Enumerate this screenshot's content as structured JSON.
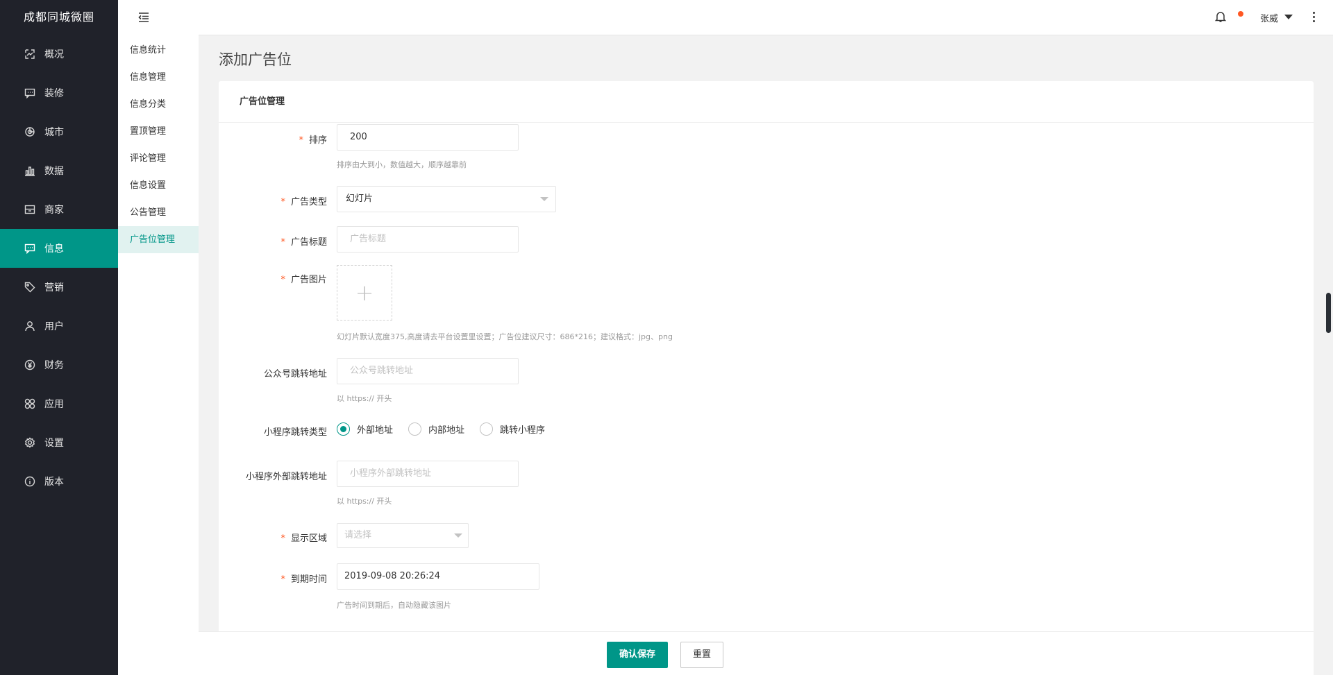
{
  "app": {
    "brand": "成都同城微圈"
  },
  "sidebar": {
    "items": [
      {
        "label": "概况",
        "icon": "dashboard-icon"
      },
      {
        "label": "装修",
        "icon": "chat-icon"
      },
      {
        "label": "城市",
        "icon": "pie-icon"
      },
      {
        "label": "数据",
        "icon": "bar-chart-icon"
      },
      {
        "label": "商家",
        "icon": "store-icon"
      },
      {
        "label": "信息",
        "icon": "message-icon",
        "active": true
      },
      {
        "label": "营销",
        "icon": "tag-icon"
      },
      {
        "label": "用户",
        "icon": "user-icon"
      },
      {
        "label": "财务",
        "icon": "yen-icon"
      },
      {
        "label": "应用",
        "icon": "apps-icon"
      },
      {
        "label": "设置",
        "icon": "gear-icon"
      },
      {
        "label": "版本",
        "icon": "info-icon"
      }
    ]
  },
  "submenu": {
    "items": [
      {
        "label": "信息统计"
      },
      {
        "label": "信息管理"
      },
      {
        "label": "信息分类"
      },
      {
        "label": "置顶管理"
      },
      {
        "label": "评论管理"
      },
      {
        "label": "信息设置"
      },
      {
        "label": "公告管理"
      },
      {
        "label": "广告位管理",
        "active": true
      }
    ]
  },
  "header": {
    "user_name": "张威"
  },
  "page": {
    "title": "添加广告位",
    "card_title": "广告位管理"
  },
  "form": {
    "sort": {
      "label": "排序",
      "value": "200",
      "hint": "排序由大到小，数值越大，顺序越靠前"
    },
    "ad_type": {
      "label": "广告类型",
      "value": "幻灯片"
    },
    "ad_title": {
      "label": "广告标题",
      "placeholder": "广告标题"
    },
    "ad_image": {
      "label": "广告图片",
      "plus": "+",
      "hint": "幻灯片默认宽度375,高度请去平台设置里设置；广告位建议尺寸：686*216；建议格式：jpg、png"
    },
    "mp_url": {
      "label": "公众号跳转地址",
      "placeholder": "公众号跳转地址",
      "hint": "以 https:// 开头"
    },
    "jump_type": {
      "label": "小程序跳转类型",
      "options": [
        "外部地址",
        "内部地址",
        "跳转小程序"
      ],
      "selected": "外部地址"
    },
    "mini_url": {
      "label": "小程序外部跳转地址",
      "placeholder": "小程序外部跳转地址",
      "hint": "以 https:// 开头"
    },
    "area": {
      "label": "显示区域",
      "placeholder": "请选择"
    },
    "expire": {
      "label": "到期时间",
      "value": "2019-09-08 20:26:24",
      "hint": "广告时间到期后，自动隐藏该图片"
    }
  },
  "actions": {
    "save": "确认保存",
    "reset": "重置"
  },
  "colors": {
    "primary": "#009688",
    "sidebar_bg": "#20222a",
    "required": "#ff5722"
  }
}
